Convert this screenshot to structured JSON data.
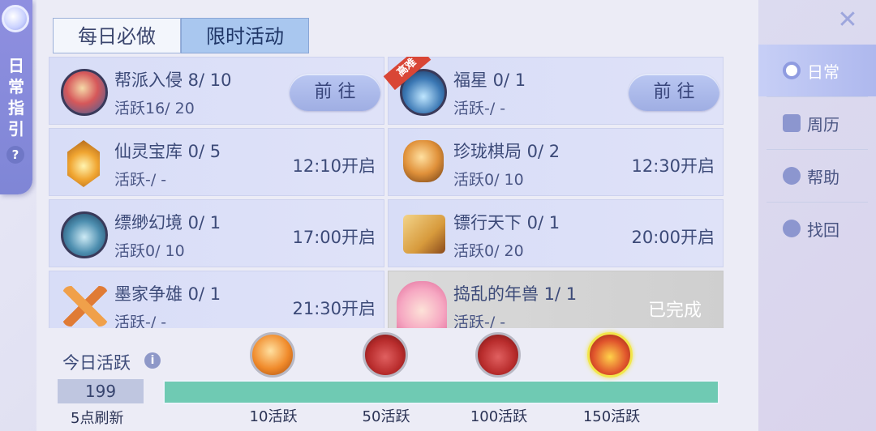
{
  "left_tab": {
    "label": "日常指引",
    "help": "?"
  },
  "tabs": [
    {
      "label": "每日必做",
      "active": false
    },
    {
      "label": "限时活动",
      "active": true
    }
  ],
  "cards": [
    {
      "name": "帮派入侵 8/ 10",
      "activity": "活跃16/ 20",
      "action": "前 往",
      "type": "button",
      "icon": "gang-invasion-icon"
    },
    {
      "name": "福星 0/ 1",
      "activity": "活跃-/ -",
      "action": "前 往",
      "type": "button",
      "icon": "lucky-star-icon",
      "ribbon": "高难"
    },
    {
      "name": "仙灵宝库 0/ 5",
      "activity": "活跃-/ -",
      "action": "12:10开启",
      "type": "time",
      "icon": "fairy-treasury-icon"
    },
    {
      "name": "珍珑棋局 0/ 2",
      "activity": "活跃0/ 10",
      "action": "12:30开启",
      "type": "time",
      "icon": "chess-game-icon"
    },
    {
      "name": "缥缈幻境 0/ 1",
      "activity": "活跃0/ 10",
      "action": "17:00开启",
      "type": "time",
      "icon": "illusion-realm-icon"
    },
    {
      "name": "镖行天下 0/ 1",
      "activity": "活跃0/ 20",
      "action": "20:00开启",
      "type": "time",
      "icon": "escort-scroll-icon"
    },
    {
      "name": "墨家争雄 0/ 1",
      "activity": "活跃-/ -",
      "action": "21:30开启",
      "type": "time",
      "icon": "crossed-swords-icon"
    },
    {
      "name": "捣乱的年兽 1/ 1",
      "activity": "活跃-/ -",
      "action": "已完成",
      "type": "done",
      "icon": "nian-beast-icon"
    }
  ],
  "today": {
    "label": "今日活跃",
    "score": "199",
    "refresh": "5点刷新",
    "progress": 1.0,
    "milestones": [
      {
        "label": "10活跃",
        "icon": "orb-reward-icon"
      },
      {
        "label": "50活跃",
        "icon": "red-pouch-icon"
      },
      {
        "label": "100活跃",
        "icon": "red-pouch-icon"
      },
      {
        "label": "150活跃",
        "icon": "gift-box-icon"
      }
    ]
  },
  "side_nav": [
    {
      "label": "日常",
      "active": true
    },
    {
      "label": "周历",
      "active": false
    },
    {
      "label": "帮助",
      "active": false
    },
    {
      "label": "找回",
      "active": false
    }
  ],
  "colors": {
    "progress_fill": "#6fcab3",
    "ribbon": "#d94636",
    "active_tab": "#a9c7ef"
  }
}
